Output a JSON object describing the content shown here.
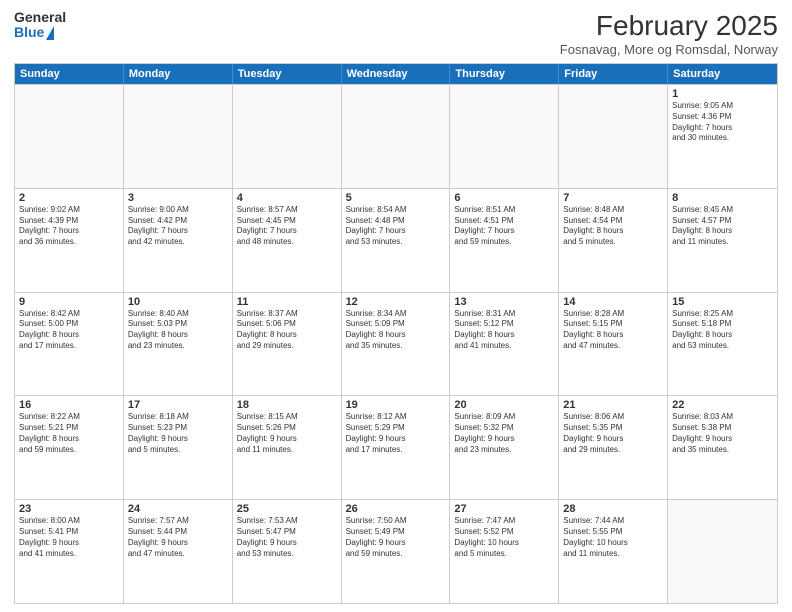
{
  "header": {
    "logo": {
      "general": "General",
      "blue": "Blue"
    },
    "title": "February 2025",
    "location": "Fosnavag, More og Romsdal, Norway"
  },
  "days_of_week": [
    "Sunday",
    "Monday",
    "Tuesday",
    "Wednesday",
    "Thursday",
    "Friday",
    "Saturday"
  ],
  "weeks": [
    [
      {
        "day": "",
        "info": ""
      },
      {
        "day": "",
        "info": ""
      },
      {
        "day": "",
        "info": ""
      },
      {
        "day": "",
        "info": ""
      },
      {
        "day": "",
        "info": ""
      },
      {
        "day": "",
        "info": ""
      },
      {
        "day": "1",
        "info": "Sunrise: 9:05 AM\nSunset: 4:36 PM\nDaylight: 7 hours\nand 30 minutes."
      }
    ],
    [
      {
        "day": "2",
        "info": "Sunrise: 9:02 AM\nSunset: 4:39 PM\nDaylight: 7 hours\nand 36 minutes."
      },
      {
        "day": "3",
        "info": "Sunrise: 9:00 AM\nSunset: 4:42 PM\nDaylight: 7 hours\nand 42 minutes."
      },
      {
        "day": "4",
        "info": "Sunrise: 8:57 AM\nSunset: 4:45 PM\nDaylight: 7 hours\nand 48 minutes."
      },
      {
        "day": "5",
        "info": "Sunrise: 8:54 AM\nSunset: 4:48 PM\nDaylight: 7 hours\nand 53 minutes."
      },
      {
        "day": "6",
        "info": "Sunrise: 8:51 AM\nSunset: 4:51 PM\nDaylight: 7 hours\nand 59 minutes."
      },
      {
        "day": "7",
        "info": "Sunrise: 8:48 AM\nSunset: 4:54 PM\nDaylight: 8 hours\nand 5 minutes."
      },
      {
        "day": "8",
        "info": "Sunrise: 8:45 AM\nSunset: 4:57 PM\nDaylight: 8 hours\nand 11 minutes."
      }
    ],
    [
      {
        "day": "9",
        "info": "Sunrise: 8:42 AM\nSunset: 5:00 PM\nDaylight: 8 hours\nand 17 minutes."
      },
      {
        "day": "10",
        "info": "Sunrise: 8:40 AM\nSunset: 5:03 PM\nDaylight: 8 hours\nand 23 minutes."
      },
      {
        "day": "11",
        "info": "Sunrise: 8:37 AM\nSunset: 5:06 PM\nDaylight: 8 hours\nand 29 minutes."
      },
      {
        "day": "12",
        "info": "Sunrise: 8:34 AM\nSunset: 5:09 PM\nDaylight: 8 hours\nand 35 minutes."
      },
      {
        "day": "13",
        "info": "Sunrise: 8:31 AM\nSunset: 5:12 PM\nDaylight: 8 hours\nand 41 minutes."
      },
      {
        "day": "14",
        "info": "Sunrise: 8:28 AM\nSunset: 5:15 PM\nDaylight: 8 hours\nand 47 minutes."
      },
      {
        "day": "15",
        "info": "Sunrise: 8:25 AM\nSunset: 5:18 PM\nDaylight: 8 hours\nand 53 minutes."
      }
    ],
    [
      {
        "day": "16",
        "info": "Sunrise: 8:22 AM\nSunset: 5:21 PM\nDaylight: 8 hours\nand 59 minutes."
      },
      {
        "day": "17",
        "info": "Sunrise: 8:18 AM\nSunset: 5:23 PM\nDaylight: 9 hours\nand 5 minutes."
      },
      {
        "day": "18",
        "info": "Sunrise: 8:15 AM\nSunset: 5:26 PM\nDaylight: 9 hours\nand 11 minutes."
      },
      {
        "day": "19",
        "info": "Sunrise: 8:12 AM\nSunset: 5:29 PM\nDaylight: 9 hours\nand 17 minutes."
      },
      {
        "day": "20",
        "info": "Sunrise: 8:09 AM\nSunset: 5:32 PM\nDaylight: 9 hours\nand 23 minutes."
      },
      {
        "day": "21",
        "info": "Sunrise: 8:06 AM\nSunset: 5:35 PM\nDaylight: 9 hours\nand 29 minutes."
      },
      {
        "day": "22",
        "info": "Sunrise: 8:03 AM\nSunset: 5:38 PM\nDaylight: 9 hours\nand 35 minutes."
      }
    ],
    [
      {
        "day": "23",
        "info": "Sunrise: 8:00 AM\nSunset: 5:41 PM\nDaylight: 9 hours\nand 41 minutes."
      },
      {
        "day": "24",
        "info": "Sunrise: 7:57 AM\nSunset: 5:44 PM\nDaylight: 9 hours\nand 47 minutes."
      },
      {
        "day": "25",
        "info": "Sunrise: 7:53 AM\nSunset: 5:47 PM\nDaylight: 9 hours\nand 53 minutes."
      },
      {
        "day": "26",
        "info": "Sunrise: 7:50 AM\nSunset: 5:49 PM\nDaylight: 9 hours\nand 59 minutes."
      },
      {
        "day": "27",
        "info": "Sunrise: 7:47 AM\nSunset: 5:52 PM\nDaylight: 10 hours\nand 5 minutes."
      },
      {
        "day": "28",
        "info": "Sunrise: 7:44 AM\nSunset: 5:55 PM\nDaylight: 10 hours\nand 11 minutes."
      },
      {
        "day": "",
        "info": ""
      }
    ]
  ]
}
